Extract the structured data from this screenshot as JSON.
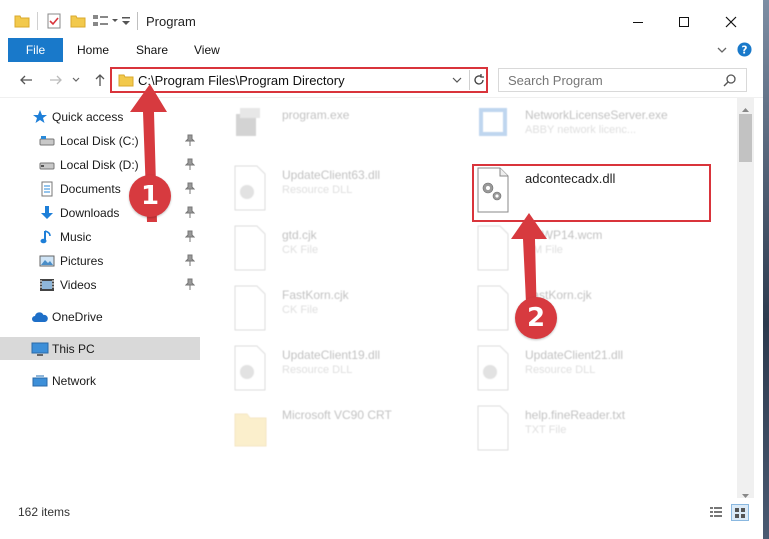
{
  "window": {
    "title": "Program",
    "colors": {
      "accent": "#1979ca",
      "annotation": "#d9343b"
    }
  },
  "ribbon": {
    "tabs": [
      {
        "label": "File"
      },
      {
        "label": "Home"
      },
      {
        "label": "Share"
      },
      {
        "label": "View"
      }
    ]
  },
  "address": {
    "path": "C:\\Program Files\\Program Directory",
    "search_placeholder": "Search Program"
  },
  "nav": {
    "items": [
      {
        "label": "Quick access",
        "icon": "star-icon"
      },
      {
        "label": "Local Disk (C:)",
        "icon": "drive-icon",
        "pinned": true
      },
      {
        "label": "Local Disk (D:)",
        "icon": "drive-icon",
        "pinned": true
      },
      {
        "label": "Documents",
        "icon": "documents-icon",
        "pinned": true
      },
      {
        "label": "Downloads",
        "icon": "downloads-icon",
        "pinned": true
      },
      {
        "label": "Music",
        "icon": "music-icon",
        "pinned": true
      },
      {
        "label": "Pictures",
        "icon": "pictures-icon",
        "pinned": true
      },
      {
        "label": "Videos",
        "icon": "videos-icon",
        "pinned": true
      },
      {
        "label": "OneDrive",
        "icon": "cloud-icon"
      },
      {
        "label": "This PC",
        "icon": "computer-icon",
        "selected": true
      },
      {
        "label": "Network",
        "icon": "network-icon"
      }
    ]
  },
  "files": [
    {
      "name": "program.exe",
      "type": "",
      "icon": "exe-icon"
    },
    {
      "name": "NetworkLicenseServer.exe",
      "type": "ABBY network licenc...",
      "icon": "exe-icon"
    },
    {
      "name": "UpdateClient63.dll",
      "type": "Resource DLL",
      "icon": "dll-icon"
    },
    {
      "name": "adcontecadx.dll",
      "type": "",
      "icon": "dll-icon"
    },
    {
      "name": "gtd.cjk",
      "type": "CK File",
      "icon": "file-icon"
    },
    {
      "name": "ttfoWP14.wcm",
      "type": "CM File",
      "icon": "file-icon"
    },
    {
      "name": "FastKorn.cjk",
      "type": "CK File",
      "icon": "file-icon"
    },
    {
      "name": "FastKorn.cjk",
      "type": "",
      "icon": "file-icon"
    },
    {
      "name": "UpdateClient19.dll",
      "type": "Resource DLL",
      "icon": "dll-icon"
    },
    {
      "name": "UpdateClient21.dll",
      "type": "Resource DLL",
      "icon": "dll-icon"
    },
    {
      "name": "Microsoft VC90 CRT",
      "type": "",
      "icon": "folder-icon"
    },
    {
      "name": "help.fineReader.txt",
      "type": "TXT File",
      "icon": "file-icon"
    }
  ],
  "status": {
    "items_count": "162 items"
  },
  "annotations": {
    "step1": "1",
    "step2": "2"
  }
}
